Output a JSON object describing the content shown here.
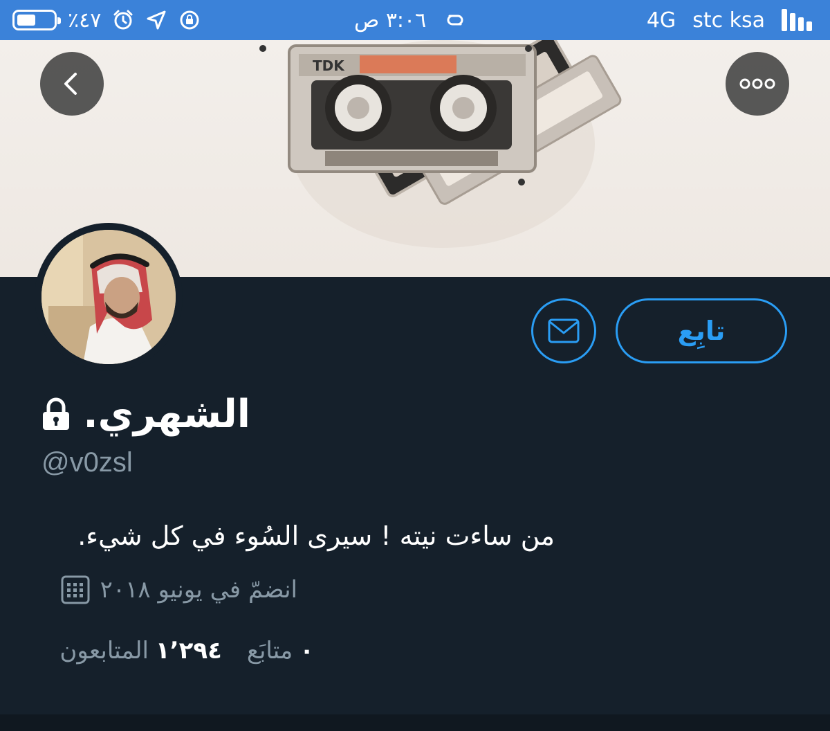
{
  "status_bar": {
    "battery_percent": "٪٤٧",
    "time": "٣:٠٦ ص",
    "network_type": "4G",
    "carrier": "stc ksa"
  },
  "banner": {
    "back_label": "",
    "more_label": ""
  },
  "profile": {
    "follow_label": "تابِع",
    "display_name": "الشهري.",
    "handle": "@v0zsl",
    "bio": "من ساءت نيته ! سيرى السُوء في كل شيء.",
    "joined": "انضمّ في يونيو ٢٠١٨",
    "following_count": "٠",
    "following_label": "متابَع",
    "followers_count": "١٬٢٩٤",
    "followers_label": "المتابعون"
  },
  "colors": {
    "status_bar_bg": "#3b82d9",
    "page_bg": "#15202b",
    "accent": "#2a9df4",
    "secondary_text": "#8899a6"
  }
}
